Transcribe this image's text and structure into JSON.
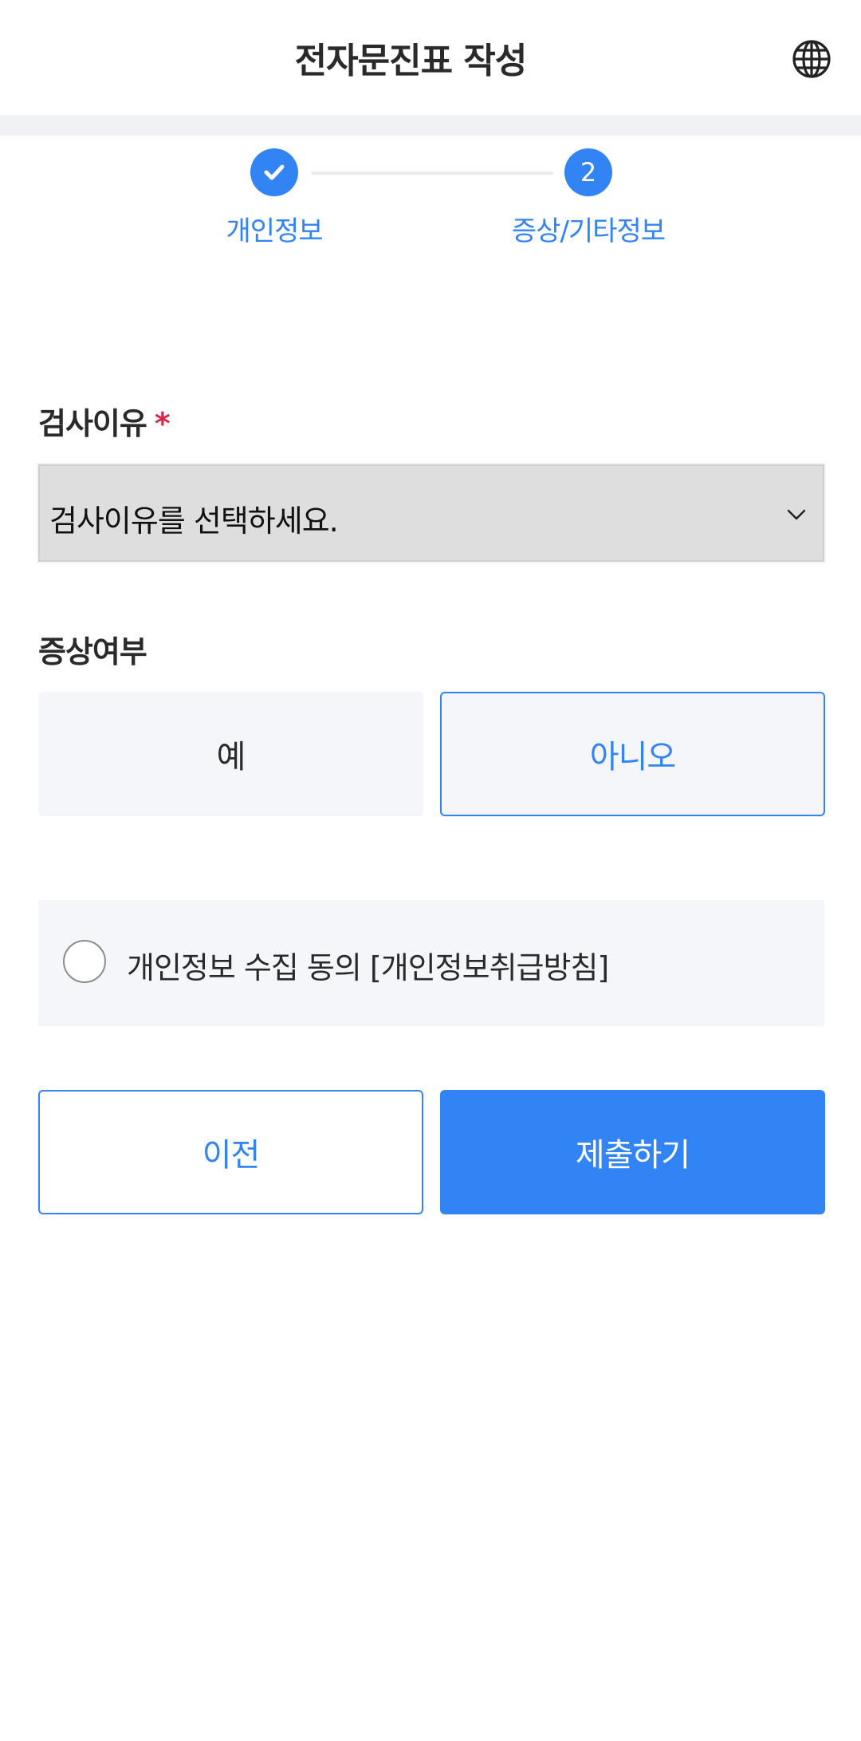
{
  "header": {
    "title": "전자문진표 작성",
    "language_icon": "globe-icon"
  },
  "stepper": {
    "steps": [
      {
        "label": "개인정보",
        "state": "completed",
        "icon": "check-icon"
      },
      {
        "label": "증상/기타정보",
        "state": "current",
        "number": "2"
      }
    ],
    "accent_color": "#3284f5"
  },
  "form": {
    "reason": {
      "label": "검사이유",
      "required_mark": "*",
      "placeholder": "검사이유를 선택하세요.",
      "icon": "chevron-down-icon"
    },
    "symptom": {
      "label": "증상여부",
      "options": [
        "예",
        "아니오"
      ],
      "selected": "아니오"
    },
    "consent": {
      "text": "개인정보 수집 동의 [개인정보취급방침]",
      "checked": false
    }
  },
  "actions": {
    "prev_label": "이전",
    "submit_label": "제출하기"
  }
}
